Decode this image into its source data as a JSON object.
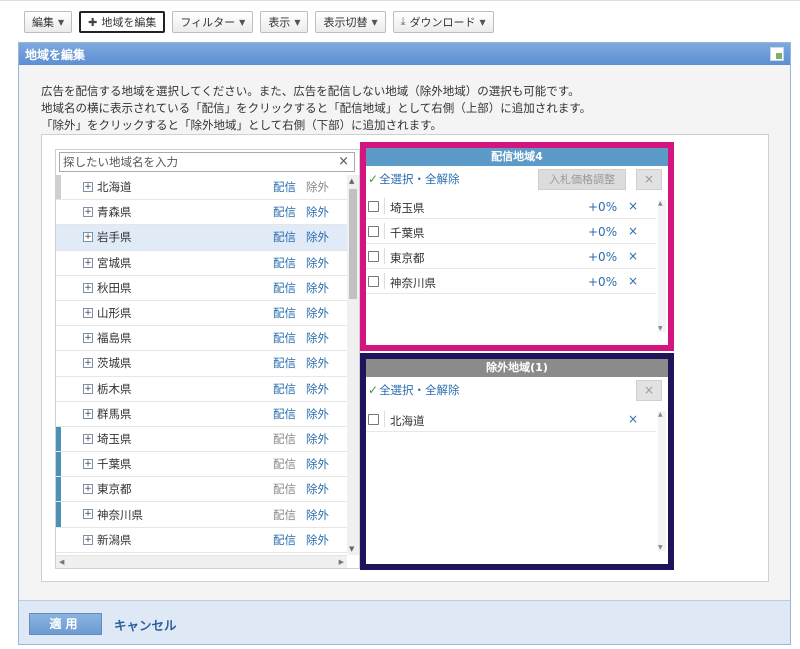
{
  "toolbar": {
    "edit": "編集",
    "edit_region": "地域を編集",
    "filter": "フィルター",
    "view": "表示",
    "view_switch": "表示切替",
    "download": "ダウンロード"
  },
  "dialog": {
    "title": "地域を編集",
    "desc1": "広告を配信する地域を選択してください。また、広告を配信しない地域（除外地域）の選択も可能です。",
    "desc2": "地域名の横に表示されている「配信」をクリックすると「配信地域」として右側（上部）に追加されます。",
    "desc3": "「除外」をクリックすると「除外地域」として右側（下部）に追加されます。"
  },
  "search": {
    "placeholder": "探したい地域名を入力",
    "clear": "×"
  },
  "left_list": [
    {
      "name": "北海道",
      "deliver": "配信",
      "exclude": "除外",
      "marker": "gray",
      "deliver_active": true,
      "exclude_active": false,
      "selected": false
    },
    {
      "name": "青森県",
      "deliver": "配信",
      "exclude": "除外",
      "marker": "none",
      "deliver_active": true,
      "exclude_active": true,
      "selected": false
    },
    {
      "name": "岩手県",
      "deliver": "配信",
      "exclude": "除外",
      "marker": "none",
      "deliver_active": true,
      "exclude_active": true,
      "selected": true
    },
    {
      "name": "宮城県",
      "deliver": "配信",
      "exclude": "除外",
      "marker": "none",
      "deliver_active": true,
      "exclude_active": true,
      "selected": false
    },
    {
      "name": "秋田県",
      "deliver": "配信",
      "exclude": "除外",
      "marker": "none",
      "deliver_active": true,
      "exclude_active": true,
      "selected": false
    },
    {
      "name": "山形県",
      "deliver": "配信",
      "exclude": "除外",
      "marker": "none",
      "deliver_active": true,
      "exclude_active": true,
      "selected": false
    },
    {
      "name": "福島県",
      "deliver": "配信",
      "exclude": "除外",
      "marker": "none",
      "deliver_active": true,
      "exclude_active": true,
      "selected": false
    },
    {
      "name": "茨城県",
      "deliver": "配信",
      "exclude": "除外",
      "marker": "none",
      "deliver_active": true,
      "exclude_active": true,
      "selected": false
    },
    {
      "name": "栃木県",
      "deliver": "配信",
      "exclude": "除外",
      "marker": "none",
      "deliver_active": true,
      "exclude_active": true,
      "selected": false
    },
    {
      "name": "群馬県",
      "deliver": "配信",
      "exclude": "除外",
      "marker": "none",
      "deliver_active": true,
      "exclude_active": true,
      "selected": false
    },
    {
      "name": "埼玉県",
      "deliver": "配信",
      "exclude": "除外",
      "marker": "blue",
      "deliver_active": false,
      "exclude_active": true,
      "selected": false
    },
    {
      "name": "千葉県",
      "deliver": "配信",
      "exclude": "除外",
      "marker": "blue",
      "deliver_active": false,
      "exclude_active": true,
      "selected": false
    },
    {
      "name": "東京都",
      "deliver": "配信",
      "exclude": "除外",
      "marker": "blue",
      "deliver_active": false,
      "exclude_active": true,
      "selected": false
    },
    {
      "name": "神奈川県",
      "deliver": "配信",
      "exclude": "除外",
      "marker": "blue",
      "deliver_active": false,
      "exclude_active": true,
      "selected": false
    },
    {
      "name": "新潟県",
      "deliver": "配信",
      "exclude": "除外",
      "marker": "none",
      "deliver_active": true,
      "exclude_active": true,
      "selected": false
    }
  ],
  "delivery": {
    "header": "配信地域4",
    "select_all": "全選択・全解除",
    "bid_button": "入札価格調整",
    "clear": "×",
    "items": [
      {
        "name": "埼玉県",
        "pct": "+0%",
        "del": "×"
      },
      {
        "name": "千葉県",
        "pct": "+0%",
        "del": "×"
      },
      {
        "name": "東京都",
        "pct": "+0%",
        "del": "×"
      },
      {
        "name": "神奈川県",
        "pct": "+0%",
        "del": "×"
      }
    ]
  },
  "excluded": {
    "header": "除外地域(1)",
    "select_all": "全選択・全解除",
    "clear": "×",
    "items": [
      {
        "name": "北海道",
        "del": "×"
      }
    ]
  },
  "footer": {
    "apply": "適用",
    "cancel": "キャンセル"
  },
  "colors": {
    "delivery_border": "#d4147f",
    "excluded_border": "#1f145a",
    "title_bar": "#6b9ad8",
    "link": "#2a6db0"
  }
}
